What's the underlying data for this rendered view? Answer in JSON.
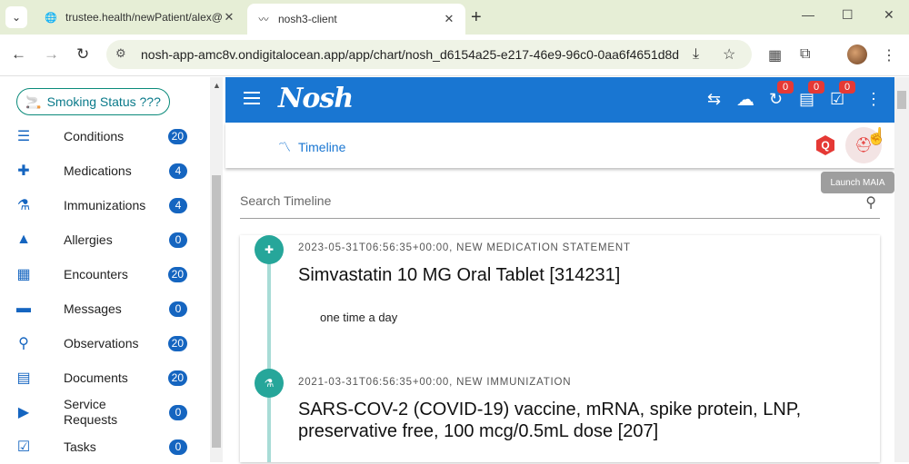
{
  "browser": {
    "tabs": [
      {
        "title": "trustee.health/newPatient/alex@",
        "icon": "globe-icon"
      },
      {
        "title": "nosh3-client",
        "icon": "nosh-icon"
      }
    ],
    "url": "nosh-app-amc8v.ondigitalocean.app/app/chart/nosh_d6154a25-e217-46e9-96c0-0aa6f4651d8d"
  },
  "sidebar": {
    "smoking_status": "Smoking Status ???",
    "items": [
      {
        "label": "Conditions",
        "count": "20",
        "icon": "list-icon"
      },
      {
        "label": "Medications",
        "count": "4",
        "icon": "medication-icon"
      },
      {
        "label": "Immunizations",
        "count": "4",
        "icon": "vaccine-icon"
      },
      {
        "label": "Allergies",
        "count": "0",
        "icon": "warning-icon"
      },
      {
        "label": "Encounters",
        "count": "20",
        "icon": "calendar-icon"
      },
      {
        "label": "Messages",
        "count": "0",
        "icon": "message-icon"
      },
      {
        "label": "Observations",
        "count": "20",
        "icon": "microscope-icon"
      },
      {
        "label": "Documents",
        "count": "20",
        "icon": "document-icon"
      },
      {
        "label": "Service Requests",
        "count": "0",
        "icon": "service-request-icon"
      },
      {
        "label": "Tasks",
        "count": "0",
        "icon": "task-icon"
      }
    ]
  },
  "appbar": {
    "logo": "Nosh",
    "badges": {
      "sync": "0",
      "messages": "0",
      "tasks": "0"
    }
  },
  "subbar": {
    "timeline_label": "Timeline",
    "q_label": "Q",
    "tooltip": "Launch MAIA"
  },
  "search": {
    "placeholder": "Search Timeline"
  },
  "timeline": [
    {
      "meta": "2023-05-31T06:56:35+00:00, NEW MEDICATION STATEMENT",
      "title": "Simvastatin 10 MG Oral Tablet [314231]",
      "note": "one time a day"
    },
    {
      "meta": "2021-03-31T06:56:35+00:00, NEW IMMUNIZATION",
      "title": "SARS-COV-2 (COVID-19) vaccine, mRNA, spike protein, LNP, preservative free, 100 mcg/0.5mL dose [207]",
      "note": ""
    }
  ],
  "colors": {
    "primary": "#1976d2",
    "accent": "#26a69a",
    "badge": "#e53935"
  }
}
